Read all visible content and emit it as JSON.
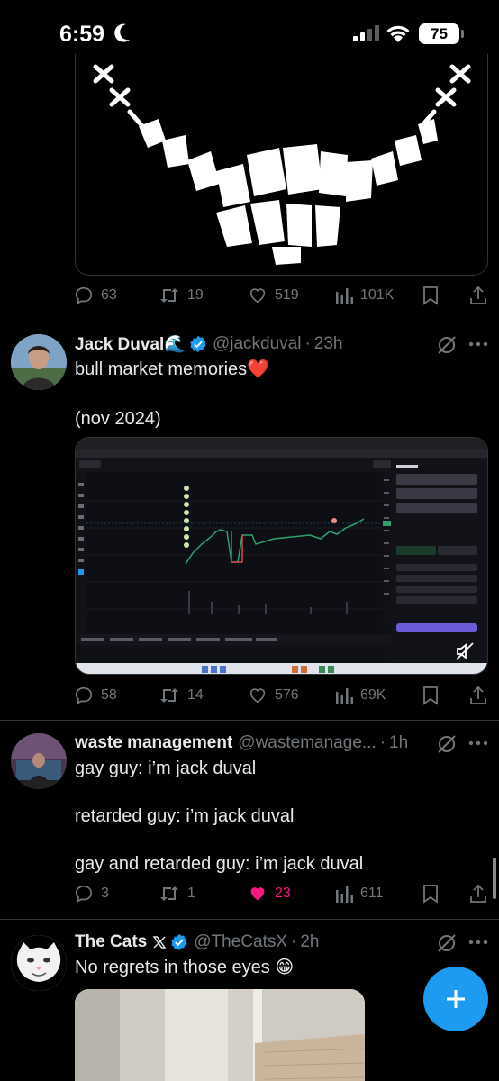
{
  "status_bar": {
    "time": "6:59",
    "battery": "75"
  },
  "tweets": [
    {
      "stats": {
        "replies": "63",
        "retweets": "19",
        "likes": "519",
        "views": "101K"
      }
    },
    {
      "name": "Jack Duval🌊",
      "handle": "@jackduval",
      "time": "23h",
      "text_line1": "bull market memories❤️",
      "text_line2": "(nov 2024)",
      "stats": {
        "replies": "58",
        "retweets": "14",
        "likes": "576",
        "views": "69K"
      }
    },
    {
      "name": "waste management",
      "handle": "@wastemanage...",
      "time": "1h",
      "lines": [
        "gay guy: i’m jack duval",
        "retarded guy: i’m jack duval",
        "gay and retarded guy: i’m jack duval"
      ],
      "stats": {
        "replies": "3",
        "retweets": "1",
        "likes": "23",
        "views": "611"
      },
      "liked": true
    },
    {
      "name": "The Cats",
      "handle": "@TheCatsX",
      "time": "2h",
      "text": "No regrets in those eyes 😁"
    }
  ],
  "chart_screenshot": {
    "ticker": "FLYGUY",
    "buy_label": "Buy",
    "sell_label": "Sell",
    "tabs": [
      "Transactions",
      "My Holdings",
      "Top Traders",
      "Holders (108)",
      "Dev Profile",
      "Bubblemaps",
      "Orders"
    ],
    "price_badge": "0.000065"
  },
  "colors": {
    "accent": "#1d9bf0",
    "like": "#f91880",
    "muted": "#71767b",
    "divider": "#2f3336"
  }
}
